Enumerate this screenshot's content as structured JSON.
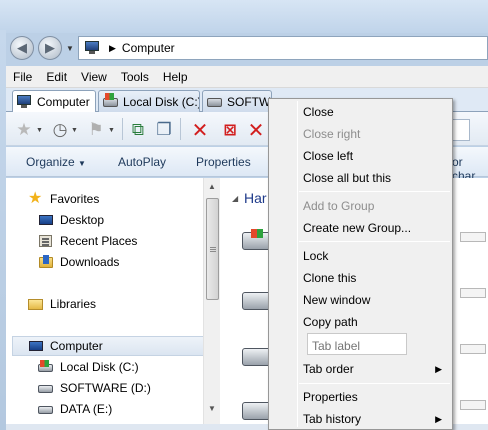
{
  "address_bar": {
    "path": [
      "Computer"
    ]
  },
  "menubar": {
    "items": [
      "File",
      "Edit",
      "View",
      "Tools",
      "Help"
    ]
  },
  "tabs": [
    {
      "label": "Computer",
      "active": true
    },
    {
      "label": "Local Disk (C:)",
      "active": false
    },
    {
      "label": "SOFTWA",
      "active": false
    }
  ],
  "commandbar": {
    "organize": "Organize",
    "autoplay": "AutoPlay",
    "properties": "Properties",
    "truncated": "or char"
  },
  "navpane": {
    "favorites": "Favorites",
    "desktop": "Desktop",
    "recent_places": "Recent Places",
    "downloads": "Downloads",
    "libraries": "Libraries",
    "computer": "Computer",
    "local_disk": "Local Disk (C:)",
    "software": "SOFTWARE (D:)",
    "data": "DATA (E:)"
  },
  "content": {
    "group_title": "Har"
  },
  "context_menu": {
    "close": "Close",
    "close_right": "Close right",
    "close_left": "Close left",
    "close_all_but_this": "Close all but this",
    "add_to_group": "Add to Group",
    "create_new_group": "Create new Group...",
    "lock": "Lock",
    "clone_this": "Clone this",
    "new_window": "New window",
    "copy_path": "Copy path",
    "tab_label_placeholder": "Tab label",
    "tab_order": "Tab order",
    "properties": "Properties",
    "tab_history": "Tab history"
  },
  "colors": {
    "accent": "#1e3a8a",
    "close_red": "#d21e1e"
  }
}
